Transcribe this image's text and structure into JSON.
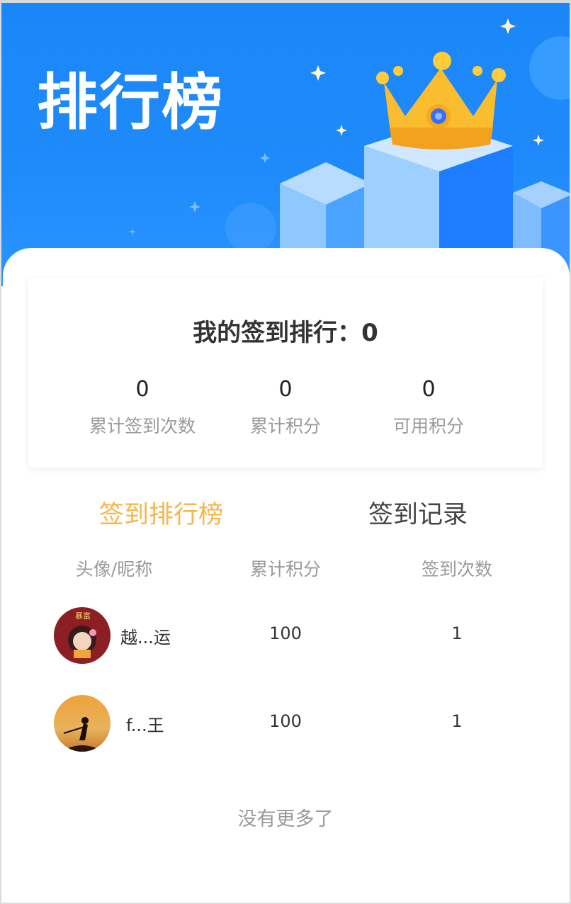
{
  "banner": {
    "title": "排行榜",
    "colors": {
      "bg": "#1a86f8",
      "crown": "#f9b52c"
    }
  },
  "my_rank": {
    "title": "我的签到排行：0",
    "stats": [
      {
        "value": "0",
        "label": "累计签到次数"
      },
      {
        "value": "0",
        "label": "累计积分"
      },
      {
        "value": "0",
        "label": "可用积分"
      }
    ]
  },
  "tabs": [
    {
      "label": "签到排行榜",
      "active": true,
      "color": "#f6b648"
    },
    {
      "label": "签到记录",
      "active": false
    }
  ],
  "table": {
    "headers": [
      "头像/昵称",
      "累计积分",
      "签到次数"
    ],
    "rows": [
      {
        "nickname": "越...运",
        "points": "100",
        "count": "1",
        "avatar_badge": "暴富"
      },
      {
        "nickname": "f...王",
        "points": "100",
        "count": "1"
      }
    ]
  },
  "footer": {
    "no_more": "没有更多了"
  }
}
